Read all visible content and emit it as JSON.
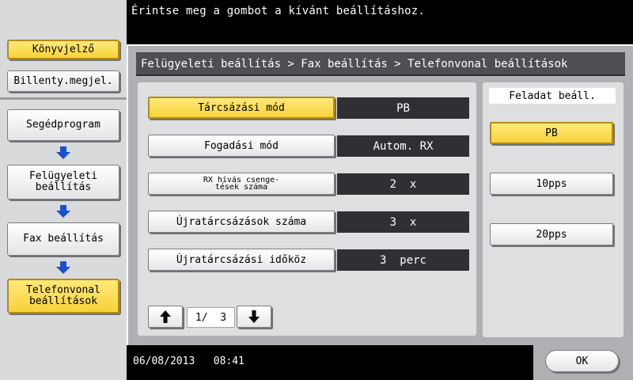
{
  "header": {
    "message": "Érintse meg a gombot a kívánt beállításhoz."
  },
  "sidebar": {
    "bookmark_label": "Könyvjelző",
    "keypad_label": "Billenty.megjel.",
    "nav": [
      {
        "label": "Segédprogram"
      },
      {
        "label": "Felügyeleti\nbeállítás"
      },
      {
        "label": "Fax beállítás"
      },
      {
        "label": "Telefonvonal\nbeállítások"
      }
    ]
  },
  "breadcrumb": "Felügyeleti beállítás > Fax beállítás > Telefonvonal beállítások",
  "settings": [
    {
      "label": "Tárcsázási mód",
      "value": "PB"
    },
    {
      "label": "Fogadási mód",
      "value": "Autom. RX"
    },
    {
      "label": "RX hívás csenge-\ntések száma",
      "value": "2  x"
    },
    {
      "label": "Újratárcsázások száma",
      "value": "3  x"
    },
    {
      "label": "Újratárcsázási időköz",
      "value": "3  perc"
    }
  ],
  "pager": {
    "indicator": "1/  3"
  },
  "task": {
    "title": "Feladat beáll.",
    "options": [
      {
        "label": "PB",
        "selected": true
      },
      {
        "label": "10pps",
        "selected": false
      },
      {
        "label": "20pps",
        "selected": false
      }
    ]
  },
  "footer": {
    "datetime": "06/08/2013   08:41",
    "ok_label": "OK"
  },
  "colors": {
    "accent": "#f7d23a",
    "arrow": "#1b4fd1",
    "panel": "#aeb0b3",
    "value_bg": "#2f3034"
  }
}
